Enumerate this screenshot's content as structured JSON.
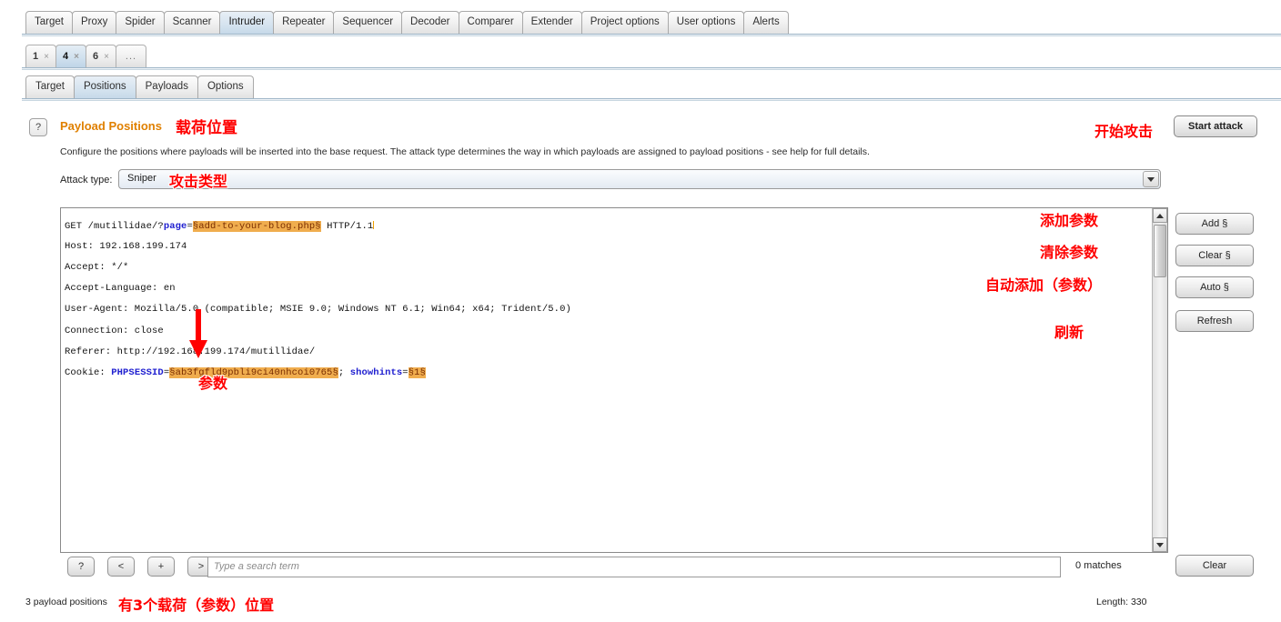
{
  "top_tabs": [
    {
      "label": "Target",
      "selected": false
    },
    {
      "label": "Proxy",
      "selected": false
    },
    {
      "label": "Spider",
      "selected": false
    },
    {
      "label": "Scanner",
      "selected": false
    },
    {
      "label": "Intruder",
      "selected": true
    },
    {
      "label": "Repeater",
      "selected": false
    },
    {
      "label": "Sequencer",
      "selected": false
    },
    {
      "label": "Decoder",
      "selected": false
    },
    {
      "label": "Comparer",
      "selected": false
    },
    {
      "label": "Extender",
      "selected": false
    },
    {
      "label": "Project options",
      "selected": false
    },
    {
      "label": "User options",
      "selected": false
    },
    {
      "label": "Alerts",
      "selected": false
    }
  ],
  "instance_tabs": [
    {
      "label": "1",
      "close": "×",
      "selected": false
    },
    {
      "label": "4",
      "close": "×",
      "selected": true
    },
    {
      "label": "6",
      "close": "×",
      "selected": false
    },
    {
      "label": "...",
      "close": "",
      "selected": false
    }
  ],
  "sub_tabs": [
    {
      "label": "Target",
      "selected": false
    },
    {
      "label": "Positions",
      "selected": true
    },
    {
      "label": "Payloads",
      "selected": false
    },
    {
      "label": "Options",
      "selected": false
    }
  ],
  "panel": {
    "help_icon": "?",
    "title": "Payload Positions",
    "description": "Configure the positions where payloads will be inserted into the base request. The attack type determines the way in which payloads are assigned to payload positions - see help for full details.",
    "start_attack_label": "Start attack"
  },
  "attack_type": {
    "label": "Attack type:",
    "value": "Sniper",
    "dropdown_icon": "chevron-down-icon"
  },
  "request": {
    "line1_prefix": "GET /mutillidae/?",
    "line1_key": "page",
    "line1_eq": "=",
    "line1_payload": "§add-to-your-blog.php§",
    "line1_suffix": " HTTP/1.1",
    "line2": "Host: 192.168.199.174",
    "line3": "Accept: */*",
    "line4": "Accept-Language: en",
    "line5": "User-Agent: Mozilla/5.0 (compatible; MSIE 9.0; Windows NT 6.1; Win64; x64; Trident/5.0)",
    "line6": "Connection: close",
    "line7": "Referer: http://192.168.199.174/mutillidae/",
    "line8_prefix": "Cookie: ",
    "line8_key1": "PHPSESSID",
    "line8_eq1": "=",
    "line8_payload1": "§ab3fgfld9pbli9ci40nhcoi0765§",
    "line8_sep": "; ",
    "line8_key2": "showhints",
    "line8_eq2": "=",
    "line8_payload2": "§1§"
  },
  "side_buttons": [
    {
      "label": "Add §"
    },
    {
      "label": "Clear §"
    },
    {
      "label": "Auto §"
    },
    {
      "label": "Refresh"
    }
  ],
  "search_bar": {
    "help_label": "?",
    "prev_label": "<",
    "plus_label": "+",
    "next_label": ">",
    "placeholder": "Type a search term",
    "value": "",
    "matches": "0 matches",
    "clear_label": "Clear"
  },
  "status": {
    "left": "3 payload positions",
    "right": "Length: 330"
  },
  "annotations": {
    "title_cn": "载荷位置",
    "start_attack_cn": "开始攻击",
    "attack_type_cn": "攻击类型",
    "add_cn": "添加参数",
    "clear_cn": "清除参数",
    "auto_cn": "自动添加（参数）",
    "refresh_cn": "刷新",
    "param_cn": "参数",
    "positions_cn": "有3个载荷（参数）位置"
  },
  "colors": {
    "annotation_red": "#ff0000",
    "panel_title_orange": "#e08000",
    "payload_highlight": "#f0ad4e",
    "header_key_blue": "#2020d0",
    "selected_tab_blue": "#c6d9e9"
  }
}
